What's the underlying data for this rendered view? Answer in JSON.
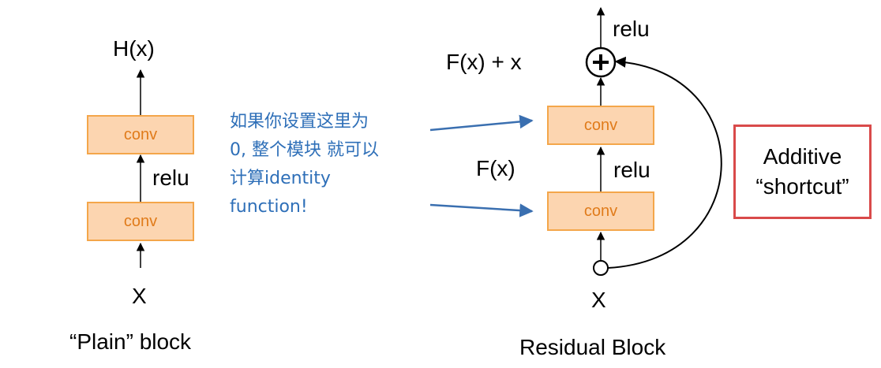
{
  "plain": {
    "output_label": "H(x)",
    "conv_top": "conv",
    "conv_bottom": "conv",
    "relu": "relu",
    "input_label": "X",
    "caption": "“Plain” block"
  },
  "residual": {
    "relu_top": "relu",
    "sum_label": "F(x) + x",
    "conv_top": "conv",
    "fx_label": "F(x)",
    "relu_mid": "relu",
    "conv_bottom": "conv",
    "input_label": "X",
    "caption": "Residual Block",
    "plus_symbol": "+"
  },
  "note": {
    "lines": [
      "如果你设置这里为",
      "0, 整个模块 就可以",
      "计算identity",
      "function!"
    ]
  },
  "shortcut_box": {
    "line1": "Additive",
    "line2": "“shortcut”"
  },
  "colors": {
    "conv_fill": "#fcd5b0",
    "conv_border": "#f4a64a",
    "conv_text": "#e07b1a",
    "note_text": "#2e6fb8",
    "shortcut_border": "#d94a4a"
  }
}
